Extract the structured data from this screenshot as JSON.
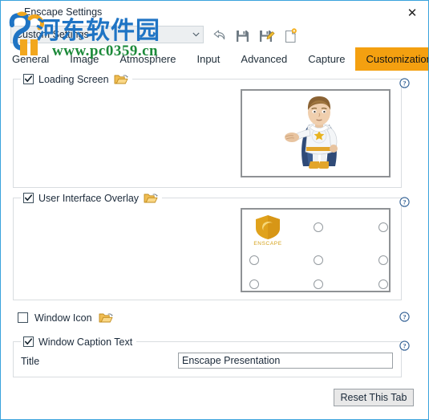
{
  "window": {
    "title": "Enscape Settings",
    "close_label": "✕",
    "border_color": "#39a3dd"
  },
  "toolbar": {
    "preset": {
      "value": "Custom Settings",
      "arrow": "⌄"
    },
    "buttons": [
      {
        "name": "undo-icon",
        "tooltip": "Undo"
      },
      {
        "name": "save-icon",
        "tooltip": "Save"
      },
      {
        "name": "save-as-icon",
        "tooltip": "Save As"
      },
      {
        "name": "new-preset-icon",
        "tooltip": "New"
      }
    ]
  },
  "tabs": {
    "active": "Customization",
    "items": [
      {
        "label": "General"
      },
      {
        "label": "Image"
      },
      {
        "label": "Atmosphere"
      },
      {
        "label": "Input"
      },
      {
        "label": "Advanced"
      },
      {
        "label": "Capture"
      },
      {
        "label": "Customization"
      }
    ]
  },
  "sections": {
    "loading_screen": {
      "label": "Loading Screen",
      "checked": true,
      "browse_icon": "folder-open-icon",
      "help_icon": "help-icon",
      "preview_alt": "superhero-character-image"
    },
    "ui_overlay": {
      "label": "User Interface Overlay",
      "checked": true,
      "browse_icon": "folder-open-icon",
      "help_icon": "help-icon",
      "logo_word": "ENSCAPE",
      "selected_position": "top-left",
      "positions": [
        "top-left",
        "top-center",
        "top-right",
        "middle-left",
        "middle-center",
        "middle-right",
        "bottom-left",
        "bottom-center",
        "bottom-right"
      ]
    },
    "window_icon": {
      "label": "Window Icon",
      "checked": false,
      "browse_icon": "folder-open-icon",
      "help_icon": "help-icon"
    },
    "window_caption_text": {
      "label": "Window Caption Text",
      "checked": true,
      "help_icon": "help-icon",
      "title_label": "Title",
      "title_value": "Enscape Presentation",
      "title_placeholder": ""
    }
  },
  "footer": {
    "reset_label": "Reset This Tab"
  },
  "watermark": {
    "chinese": "河东软件园",
    "url": "www.pc0359.cn"
  },
  "colors": {
    "accent_tab": "#f4a010",
    "window_border": "#39a3dd",
    "help_blue": "#2f5e93",
    "folder_gold": "#e3a72c"
  }
}
